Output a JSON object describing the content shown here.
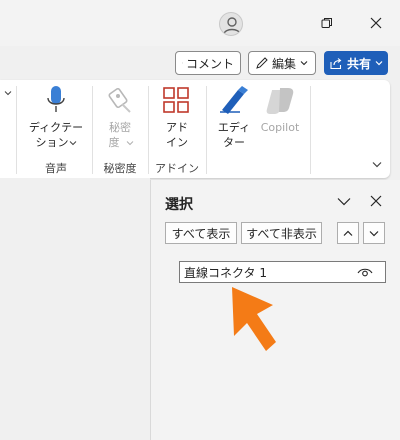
{
  "window": {
    "account_icon": "person-icon",
    "restore_icon": "restore-icon",
    "close_icon": "close-icon"
  },
  "commands": {
    "comment_label": "コメント",
    "edit_label": "編集",
    "share_label": "共有"
  },
  "ribbon": {
    "groups": [
      {
        "name": "音声",
        "buttons": [
          {
            "label_line1": "ディクテー",
            "label_line2": "ション",
            "icon": "microphone-icon",
            "disabled": false
          }
        ]
      },
      {
        "name": "秘密度",
        "buttons": [
          {
            "label_line1": "秘密",
            "label_line2": "度",
            "icon": "sensitivity-icon",
            "disabled": true
          }
        ]
      },
      {
        "name": "アドイン",
        "buttons": [
          {
            "label_line1": "アド",
            "label_line2": "イン",
            "icon": "add-ins-icon",
            "disabled": false
          }
        ]
      },
      {
        "name": "",
        "buttons": [
          {
            "label_line1": "エディ",
            "label_line2": "ター",
            "icon": "editor-icon",
            "disabled": false
          },
          {
            "label_line1": "Copilot",
            "label_line2": "",
            "icon": "copilot-icon",
            "disabled": true
          }
        ]
      }
    ]
  },
  "selection_pane": {
    "title": "選択",
    "show_all": "すべて表示",
    "hide_all": "すべて非表示",
    "items": [
      {
        "name": "直線コネクタ 1",
        "visible": true
      }
    ]
  },
  "colors": {
    "accent": "#1f5fb9",
    "arrow": "#f47b16",
    "addin_icon": "#c0392b"
  }
}
